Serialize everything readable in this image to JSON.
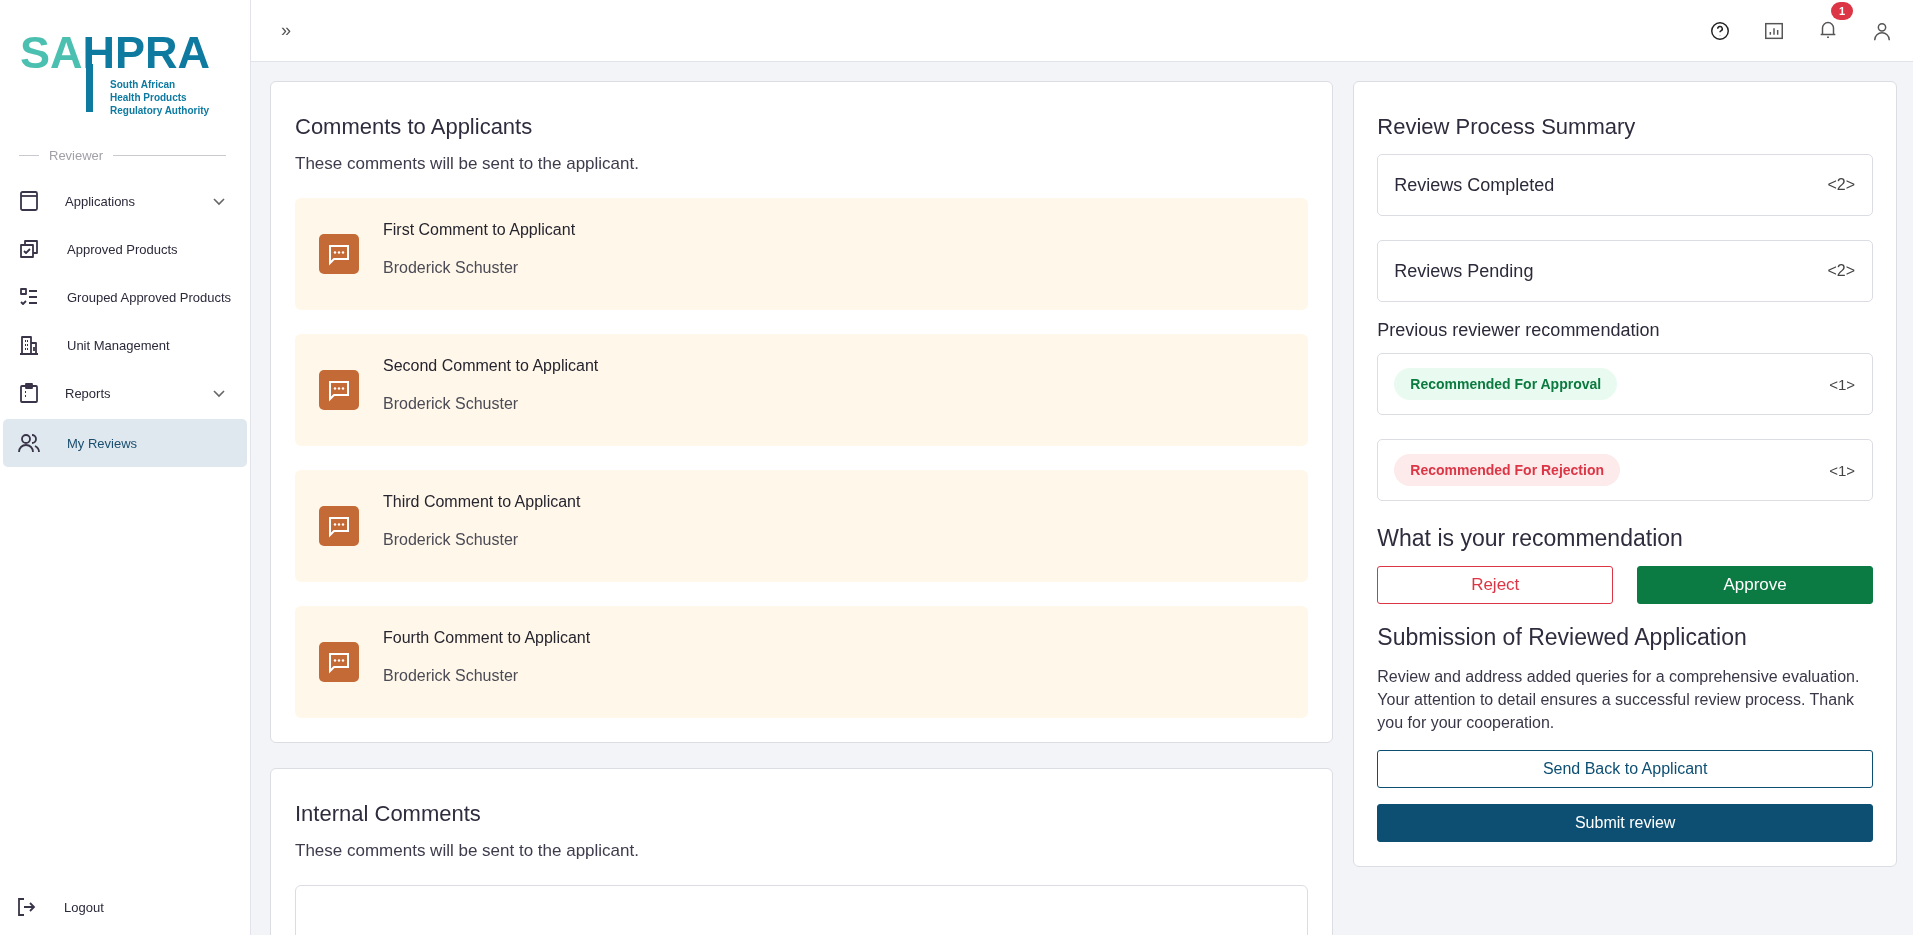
{
  "logo": {
    "part_1": "SA",
    "part_2": "HPRA",
    "tagline": [
      "South African",
      "Health Products",
      "Regulatory Authority"
    ]
  },
  "sidebar": {
    "section": "Reviewer",
    "items": [
      {
        "label": "Applications",
        "kind": "group",
        "expanded": false,
        "selected": false
      },
      {
        "label": "Approved Products",
        "kind": "link",
        "selected": false
      },
      {
        "label": "Grouped Approved Products",
        "kind": "link",
        "selected": false
      },
      {
        "label": "Unit Management",
        "kind": "link",
        "selected": false
      },
      {
        "label": "Reports",
        "kind": "group",
        "expanded": false,
        "selected": false
      },
      {
        "label": "My Reviews",
        "kind": "link",
        "selected": true
      }
    ],
    "logout": "Logout"
  },
  "header": {
    "expand": "»",
    "notification_count": "1"
  },
  "comments_to_applicants": {
    "title": "Comments to Applicants",
    "subtitle": "These comments will be sent to the applicant.",
    "comments": [
      {
        "title": "First Comment to Applicant",
        "author": "Broderick Schuster"
      },
      {
        "title": "Second Comment to Applicant",
        "author": "Broderick Schuster"
      },
      {
        "title": "Third Comment to Applicant",
        "author": "Broderick Schuster"
      },
      {
        "title": "Fourth Comment to Applicant",
        "author": "Broderick Schuster"
      }
    ]
  },
  "internal_comments": {
    "title": "Internal Comments",
    "subtitle": "These comments will be sent to the applicant."
  },
  "summary": {
    "title": "Review Process Summary",
    "counters": [
      {
        "label": "Reviews Completed",
        "value": "<2>"
      },
      {
        "label": "Reviews Pending",
        "value": "<2>"
      }
    ],
    "previous_label": "Previous reviewer recommendation",
    "previous": [
      {
        "label": "Recommended For Approval",
        "kind": "approval",
        "value": "<1>"
      },
      {
        "label": "Recommended For Rejection",
        "kind": "rejection",
        "value": "<1>"
      }
    ],
    "recommendation_title": "What is your recommendation",
    "recommendation_buttons": [
      {
        "label": "Reject",
        "kind": "reject"
      },
      {
        "label": "Approve",
        "kind": "approve"
      }
    ],
    "submission_title": "Submission of Reviewed Application",
    "submission_text": "Review and address added queries for a comprehensive evaluation. Your attention to detail ensures a successful review process. Thank you for your cooperation.",
    "send_back": "Send Back to Applicant",
    "submit": "Submit review"
  }
}
